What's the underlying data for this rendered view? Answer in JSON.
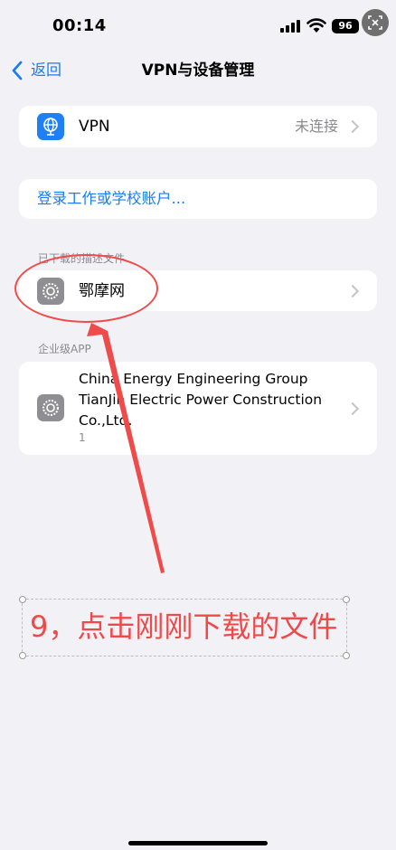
{
  "status": {
    "time": "00:14",
    "battery": "96"
  },
  "nav": {
    "back_label": "返回",
    "title": "VPN与设备管理"
  },
  "vpn_row": {
    "label": "VPN",
    "value": "未连接"
  },
  "login_row": {
    "label": "登录工作或学校账户..."
  },
  "downloaded_profiles": {
    "section_label": "已下载的描述文件",
    "items": [
      {
        "label": "鄂摩网"
      }
    ]
  },
  "enterprise_apps": {
    "section_label": "企业级APP",
    "items": [
      {
        "line1": "China Energy Engineering Group",
        "line2": "TianJin Electric Power Construction",
        "line3": "Co.,Ltd.",
        "count": "1"
      }
    ]
  },
  "annotation": {
    "text": "9，点击刚刚下载的文件",
    "color": "#ef4a4a"
  },
  "icons": {
    "vpn": "globe-network-icon",
    "profile": "gear-settings-icon",
    "enterprise": "gear-settings-icon",
    "back": "chevron-left-icon",
    "disclosure": "chevron-right-icon"
  },
  "colors": {
    "accent": "#1a7df0",
    "background": "#f2f1f6",
    "annotation": "#ef4a4a"
  }
}
